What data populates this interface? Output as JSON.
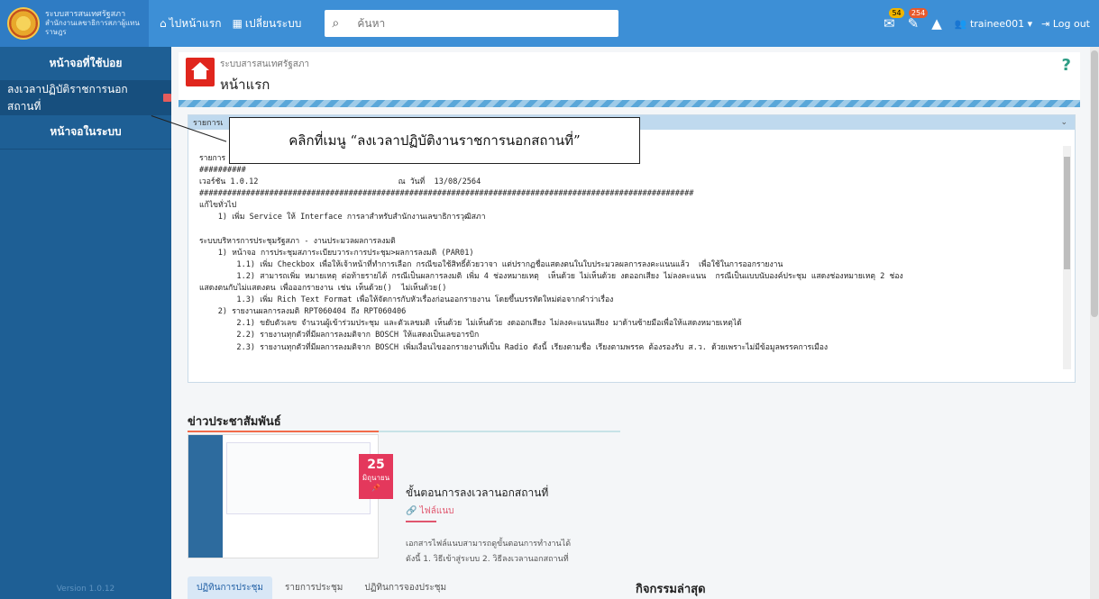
{
  "topbar": {
    "logo_line1": "ระบบสารสนเทศรัฐสภา",
    "logo_line2": "สำนักงานเลขาธิการสภาผู้แทนราษฎร",
    "home_label": "ไปหน้าแรก",
    "switch_label": "เปลี่ยนระบบ",
    "search_placeholder": "ค้นหา",
    "mail_count": "54",
    "task_count": "254",
    "user_label": "trainee001 ▾",
    "logout_label": "Log out"
  },
  "sidebar": {
    "items": [
      {
        "label": "หน้าจอที่ใช้บ่อย"
      },
      {
        "label": "ลงเวลาปฏิบัติราชการนอกสถานที่"
      },
      {
        "label": "หน้าจอในระบบ"
      }
    ],
    "version": "Version 1.0.12"
  },
  "header": {
    "system_name": "ระบบสารสนเทศรัฐสภา",
    "page_title": "หน้าแรก",
    "help": "?"
  },
  "panel": {
    "title": "รายการเ",
    "log_lines": [
      "รายการ",
      "##########",
      "เวอร์ชัน 1.0.12                              ณ วันที่  13/08/2564",
      "##########################################################################################################",
      "แก้ไขทั่วไป",
      "    1) เพิ่ม Service ให้ Interface การลาสำหรับสำนักงานเลขาธิการวุฒิสภา",
      "",
      "ระบบบริหารการประชุมรัฐสภา - งานประมวลผลการลงมติ",
      "    1) หน้าจอ การประชุมสภาระเบียบวาระการประชุม>ผลการลงมติ (PAR01)",
      "        1.1) เพิ่ม Checkbox เพื่อให้เจ้าหน้าที่ทำการเลือก กรณีขอใช้สิทธิ์ด้วยวาจา แต่ปรากฏชื่อแสดงตนในใบประมวลผลการลงคะแนนแล้ว  เพื่อใช้ในการออกรายงาน",
      "        1.2) สามารถเพิ่ม หมายเหตุ ต่อท้ายรายได้ กรณีเป็นผลการลงมติ เพิ่ม 4 ช่องหมายเหตุ  เห็นด้วย ไม่เห็นด้วย งดออกเสียง ไม่ลงคะแนน  กรณีเป็นแบบนับองค์ประชุม แสดงช่องหมายเหตุ 2 ช่อง",
      "แสดงตนกับไม่แสดงตน เพื่อออกรายงาน เช่น เห็นด้วย()  ไม่เห็นด้วย()",
      "        1.3) เพิ่ม Rich Text Format เพื่อให้จัดการกับหัวเรื่องก่อนออกรายงาน โดยขึ้นบรรทัดใหม่ต่อจากคำว่าเรื่อง",
      "    2) รายงานผลการลงมติ RPT060404 ถึง RPT060406",
      "        2.1) ขยับตัวเลข จำนวนผู้เข้าร่วมประชุม และตัวเลขมติ เห็นด้วย ไม่เห็นด้วย งดออกเสียง ไม่ลงคะแนนเสียง มาด้านซ้ายมือเพื่อให้แสดงหมายเหตุได้",
      "        2.2) รายงานทุกตัวที่มีผลการลงมติจาก BOSCH ให้แสดงเป็นเลขอารบิก",
      "        2.3) รายงานทุกตัวที่มีผลการลงมติจาก BOSCH เพิ่มเงื่อนไขออกรายงานที่เป็น Radio ดังนี้ เรียงตามชื่อ เรียงตามพรรค ต้องรองรับ ส.ว. ด้วยเพราะไม่มีข้อมูลพรรคการเมือง"
    ]
  },
  "callout": {
    "text": "คลิกที่เมนู “ลงเวลาปฏิบัติงานราชการนอกสถานที่”"
  },
  "news": {
    "section_title": "ข่าวประชาสัมพันธ์",
    "date_day": "25",
    "date_month": "มิถุนายน",
    "headline": "ขั้นตอนการลงเวลานอกสถานที่",
    "attachment_label": "ไฟล์แนบ",
    "desc_line1": "เอกสารไฟล์แนบสามารถดูขั้นตอนการทำงานได้",
    "desc_line2": "ดังนี้ 1. วิธีเข้าสู่ระบบ 2. วิธีลงเวลานอกสถานที่"
  },
  "tabs": [
    {
      "label": "ปฏิทินการประชุม"
    },
    {
      "label": "รายการประชุม"
    },
    {
      "label": "ปฏิทินการจองประชุม"
    }
  ],
  "activity_title": "กิจกรรมล่าสุด"
}
